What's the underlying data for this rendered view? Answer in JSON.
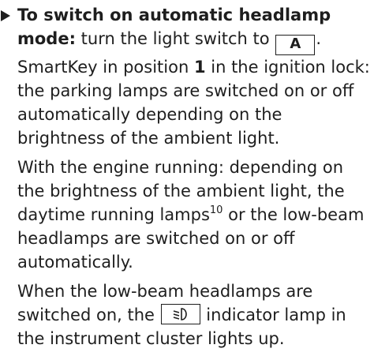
{
  "instruction": {
    "heading": "To switch on automatic headlamp mode:",
    "action": "turn the light switch to",
    "switch_position": "A",
    "trailing_punct": ".",
    "smartkey_prefix": "SmartKey in position ",
    "smartkey_position": "1",
    "smartkey_rest": " in the ignition lock: the parking lamps are switched on or off automatically depending on the brightness of the ambient light."
  },
  "engine_paragraph": {
    "text_before_note": "With the engine running: depending on the brightness of the ambient light, the daytime running lamps",
    "footnote": "10",
    "text_after_note": " or the low-beam headlamps are switched on or off automatically."
  },
  "lowbeam_paragraph": {
    "before_icon": "When the low-beam headlamps are switched on, the ",
    "icon": "low-beam-headlamp-icon",
    "after_icon": " indicator lamp in the instrument cluster lights up."
  }
}
